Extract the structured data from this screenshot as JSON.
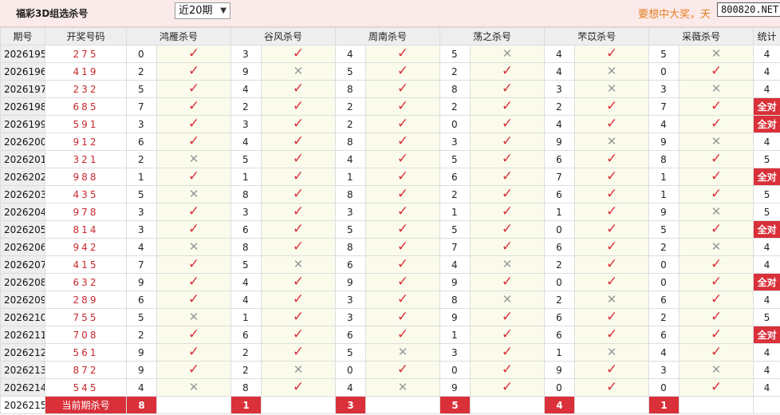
{
  "header": {
    "title": "福彩3D组选杀号",
    "select_value": "近20期",
    "slogan": "要想中大奖，天",
    "badge": "800820.NET"
  },
  "columns": [
    "期号",
    "开奖号码",
    "鸿雁杀号",
    "谷风杀号",
    "周南杀号",
    "荡之杀号",
    "芣苡杀号",
    "采薇杀号",
    "统计"
  ],
  "rows": [
    {
      "period": "2026195",
      "draw": "275",
      "e": [
        [
          "0",
          1
        ],
        [
          "3",
          1
        ],
        [
          "4",
          1
        ],
        [
          "5",
          0
        ],
        [
          "4",
          1
        ],
        [
          "5",
          0
        ]
      ],
      "count": "4"
    },
    {
      "period": "2026196",
      "draw": "419",
      "e": [
        [
          "2",
          1
        ],
        [
          "9",
          0
        ],
        [
          "5",
          1
        ],
        [
          "2",
          1
        ],
        [
          "4",
          0
        ],
        [
          "0",
          1
        ]
      ],
      "count": "4"
    },
    {
      "period": "2026197",
      "draw": "232",
      "e": [
        [
          "5",
          1
        ],
        [
          "4",
          1
        ],
        [
          "8",
          1
        ],
        [
          "8",
          1
        ],
        [
          "3",
          0
        ],
        [
          "3",
          0
        ]
      ],
      "count": "4"
    },
    {
      "period": "2026198",
      "draw": "685",
      "e": [
        [
          "7",
          1
        ],
        [
          "2",
          1
        ],
        [
          "2",
          1
        ],
        [
          "2",
          1
        ],
        [
          "2",
          1
        ],
        [
          "7",
          1
        ]
      ],
      "count": "全对"
    },
    {
      "period": "2026199",
      "draw": "591",
      "e": [
        [
          "3",
          1
        ],
        [
          "3",
          1
        ],
        [
          "2",
          1
        ],
        [
          "0",
          1
        ],
        [
          "4",
          1
        ],
        [
          "4",
          1
        ]
      ],
      "count": "全对"
    },
    {
      "period": "2026200",
      "draw": "912",
      "e": [
        [
          "6",
          1
        ],
        [
          "4",
          1
        ],
        [
          "8",
          1
        ],
        [
          "3",
          1
        ],
        [
          "9",
          0
        ],
        [
          "9",
          0
        ]
      ],
      "count": "4"
    },
    {
      "period": "2026201",
      "draw": "321",
      "e": [
        [
          "2",
          0
        ],
        [
          "5",
          1
        ],
        [
          "4",
          1
        ],
        [
          "5",
          1
        ],
        [
          "6",
          1
        ],
        [
          "8",
          1
        ]
      ],
      "count": "5"
    },
    {
      "period": "2026202",
      "draw": "988",
      "e": [
        [
          "1",
          1
        ],
        [
          "1",
          1
        ],
        [
          "1",
          1
        ],
        [
          "6",
          1
        ],
        [
          "7",
          1
        ],
        [
          "1",
          1
        ]
      ],
      "count": "全对"
    },
    {
      "period": "2026203",
      "draw": "435",
      "e": [
        [
          "5",
          0
        ],
        [
          "8",
          1
        ],
        [
          "8",
          1
        ],
        [
          "2",
          1
        ],
        [
          "6",
          1
        ],
        [
          "1",
          1
        ]
      ],
      "count": "5"
    },
    {
      "period": "2026204",
      "draw": "978",
      "e": [
        [
          "3",
          1
        ],
        [
          "3",
          1
        ],
        [
          "3",
          1
        ],
        [
          "1",
          1
        ],
        [
          "1",
          1
        ],
        [
          "9",
          0
        ]
      ],
      "count": "5"
    },
    {
      "period": "2026205",
      "draw": "814",
      "e": [
        [
          "3",
          1
        ],
        [
          "6",
          1
        ],
        [
          "5",
          1
        ],
        [
          "5",
          1
        ],
        [
          "0",
          1
        ],
        [
          "5",
          1
        ]
      ],
      "count": "全对"
    },
    {
      "period": "2026206",
      "draw": "942",
      "e": [
        [
          "4",
          0
        ],
        [
          "8",
          1
        ],
        [
          "8",
          1
        ],
        [
          "7",
          1
        ],
        [
          "6",
          1
        ],
        [
          "2",
          0
        ]
      ],
      "count": "4"
    },
    {
      "period": "2026207",
      "draw": "415",
      "e": [
        [
          "7",
          1
        ],
        [
          "5",
          0
        ],
        [
          "6",
          1
        ],
        [
          "4",
          0
        ],
        [
          "2",
          1
        ],
        [
          "0",
          1
        ]
      ],
      "count": "4"
    },
    {
      "period": "2026208",
      "draw": "632",
      "e": [
        [
          "9",
          1
        ],
        [
          "4",
          1
        ],
        [
          "9",
          1
        ],
        [
          "9",
          1
        ],
        [
          "0",
          1
        ],
        [
          "0",
          1
        ]
      ],
      "count": "全对"
    },
    {
      "period": "2026209",
      "draw": "289",
      "e": [
        [
          "6",
          1
        ],
        [
          "4",
          1
        ],
        [
          "3",
          1
        ],
        [
          "8",
          0
        ],
        [
          "2",
          0
        ],
        [
          "6",
          1
        ]
      ],
      "count": "4"
    },
    {
      "period": "2026210",
      "draw": "755",
      "e": [
        [
          "5",
          0
        ],
        [
          "1",
          1
        ],
        [
          "3",
          1
        ],
        [
          "9",
          1
        ],
        [
          "6",
          1
        ],
        [
          "2",
          1
        ]
      ],
      "count": "5"
    },
    {
      "period": "2026211",
      "draw": "708",
      "e": [
        [
          "2",
          1
        ],
        [
          "6",
          1
        ],
        [
          "6",
          1
        ],
        [
          "1",
          1
        ],
        [
          "6",
          1
        ],
        [
          "6",
          1
        ]
      ],
      "count": "全对"
    },
    {
      "period": "2026212",
      "draw": "561",
      "e": [
        [
          "9",
          1
        ],
        [
          "2",
          1
        ],
        [
          "5",
          0
        ],
        [
          "3",
          1
        ],
        [
          "1",
          0
        ],
        [
          "4",
          1
        ]
      ],
      "count": "4"
    },
    {
      "period": "2026213",
      "draw": "872",
      "e": [
        [
          "9",
          1
        ],
        [
          "2",
          0
        ],
        [
          "0",
          1
        ],
        [
          "0",
          1
        ],
        [
          "9",
          1
        ],
        [
          "3",
          0
        ]
      ],
      "count": "4"
    },
    {
      "period": "2026214",
      "draw": "545",
      "e": [
        [
          "4",
          0
        ],
        [
          "8",
          1
        ],
        [
          "4",
          0
        ],
        [
          "9",
          1
        ],
        [
          "0",
          1
        ],
        [
          "0",
          1
        ]
      ],
      "count": "4"
    }
  ],
  "footer": {
    "period": "2026215",
    "label": "当前期杀号",
    "values": [
      "8",
      "1",
      "3",
      "5",
      "4",
      "1"
    ]
  },
  "icons": {
    "correct": "check-icon",
    "wrong": "cross-icon"
  },
  "colors": {
    "accent": "#d9303a",
    "draw_text": "#c8282d",
    "slogan": "#e67e22",
    "mark_bg": "#fbfbec",
    "header_bg": "#fbeaea"
  }
}
